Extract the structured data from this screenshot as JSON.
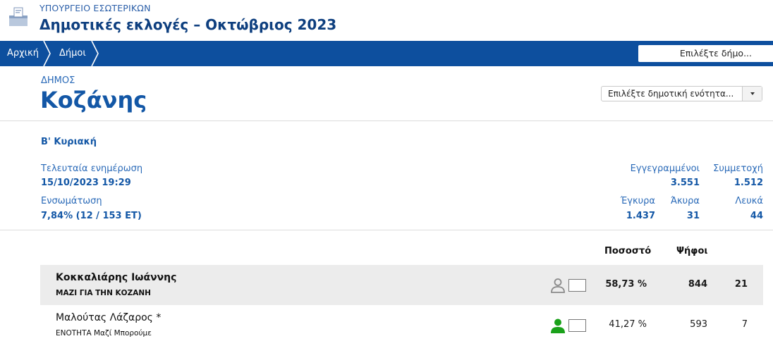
{
  "header": {
    "ministry": "ΥΠΟΥΡΓΕΙΟ ΕΣΩΤΕΡΙΚΩΝ",
    "title": "Δημοτικές εκλογές – Οκτώβριος 2023",
    "logo_icon": "ballot-box-icon"
  },
  "nav": {
    "breadcrumbs": [
      "Αρχική",
      "Δήμοι"
    ],
    "municipality_select_placeholder": "Επιλέξτε δήμο..."
  },
  "municipality": {
    "label": "ΔΗΜΟΣ",
    "name": "Κοζάνης",
    "unit_select_placeholder": "Επιλέξτε δημοτική ενότητα..."
  },
  "round": "Β' Κυριακή",
  "stats": {
    "last_update_label": "Τελευταία ενημέρωση",
    "last_update_value": "15/10/2023 19:29",
    "integration_label": "Ενσωμάτωση",
    "integration_value": "7,84% (12 / 153 ΕΤ)",
    "registered_label": "Εγγεγραμμένοι",
    "registered_value": "3.551",
    "turnout_label": "Συμμετοχή",
    "turnout_value": "1.512",
    "valid_label": "Έγκυρα",
    "valid_value": "1.437",
    "invalid_label": "Άκυρα",
    "invalid_value": "31",
    "blank_label": "Λευκά",
    "blank_value": "44"
  },
  "results": {
    "headers": {
      "percent": "Ποσοστό",
      "votes": "Ψήφοι"
    },
    "rows": [
      {
        "name": "Κοκκαλιάρης Ιωάννης",
        "party": "ΜΑΖΙ ΓΙΑ ΤΗΝ ΚΟΖΑΝΗ",
        "percent": "58,73 %",
        "votes": "844",
        "seats": "21",
        "icon": "person-outline-icon",
        "icon_color": "#8a8a8a"
      },
      {
        "name": "Μαλούτας Λάζαρος *",
        "party": "ΕΝΟΤΗΤΑ Μαζί Μπορούμε",
        "percent": "41,27 %",
        "votes": "593",
        "seats": "7",
        "icon": "person-filled-icon",
        "icon_color": "#1aa11a"
      }
    ]
  },
  "colors": {
    "brand_blue": "#0d4f9e",
    "link_blue": "#1357a6",
    "winner_green": "#1aa11a"
  }
}
